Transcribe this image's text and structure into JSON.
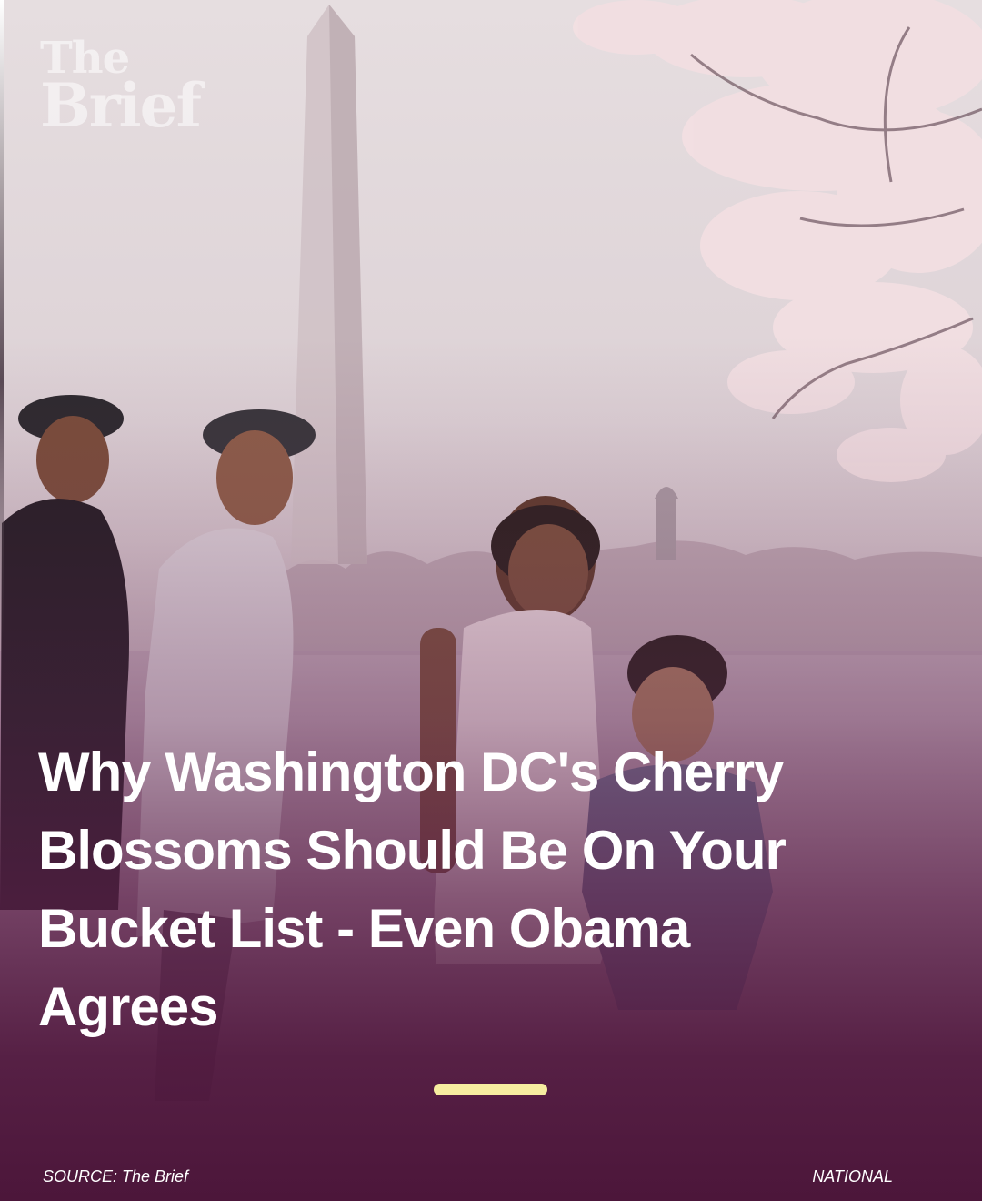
{
  "logo": {
    "line1": "The",
    "line2": "Brief"
  },
  "headline": "Why Washington DC's Cherry Blossoms Should Be On Your Bucket List - Even Obama Agrees",
  "footer": {
    "source": "SOURCE: The Brief",
    "category": "NATIONAL"
  },
  "colors": {
    "overlay": "#4c163a",
    "accent_bar": "#f6eda0",
    "headline_text": "#ffffff"
  }
}
